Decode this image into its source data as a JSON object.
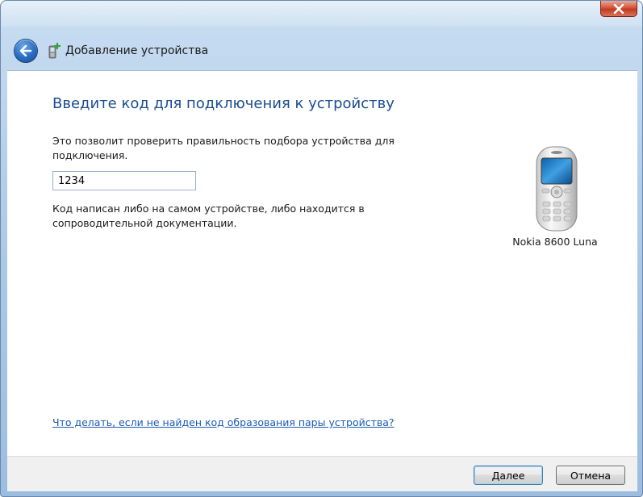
{
  "window": {
    "title": "Добавление устройства"
  },
  "main": {
    "heading": "Введите код для подключения к устройству",
    "instruction": "Это позволит проверить правильность подбора устройства для подключения.",
    "pin_value": "1234",
    "hint": "Код написан либо на самом устройстве, либо находится в сопроводительной документации.",
    "device_name": "Nokia 8600 Luna",
    "help_link": "Что делать, если не найден код образования пары устройства?"
  },
  "footer": {
    "next_label": "Далее",
    "cancel_label": "Отмена"
  },
  "colors": {
    "heading": "#1b4d8f",
    "link": "#1a5bb5",
    "close_button": "#c23a1f"
  },
  "icons": [
    "back-arrow-icon",
    "device-add-icon",
    "close-icon",
    "phone-icon"
  ]
}
